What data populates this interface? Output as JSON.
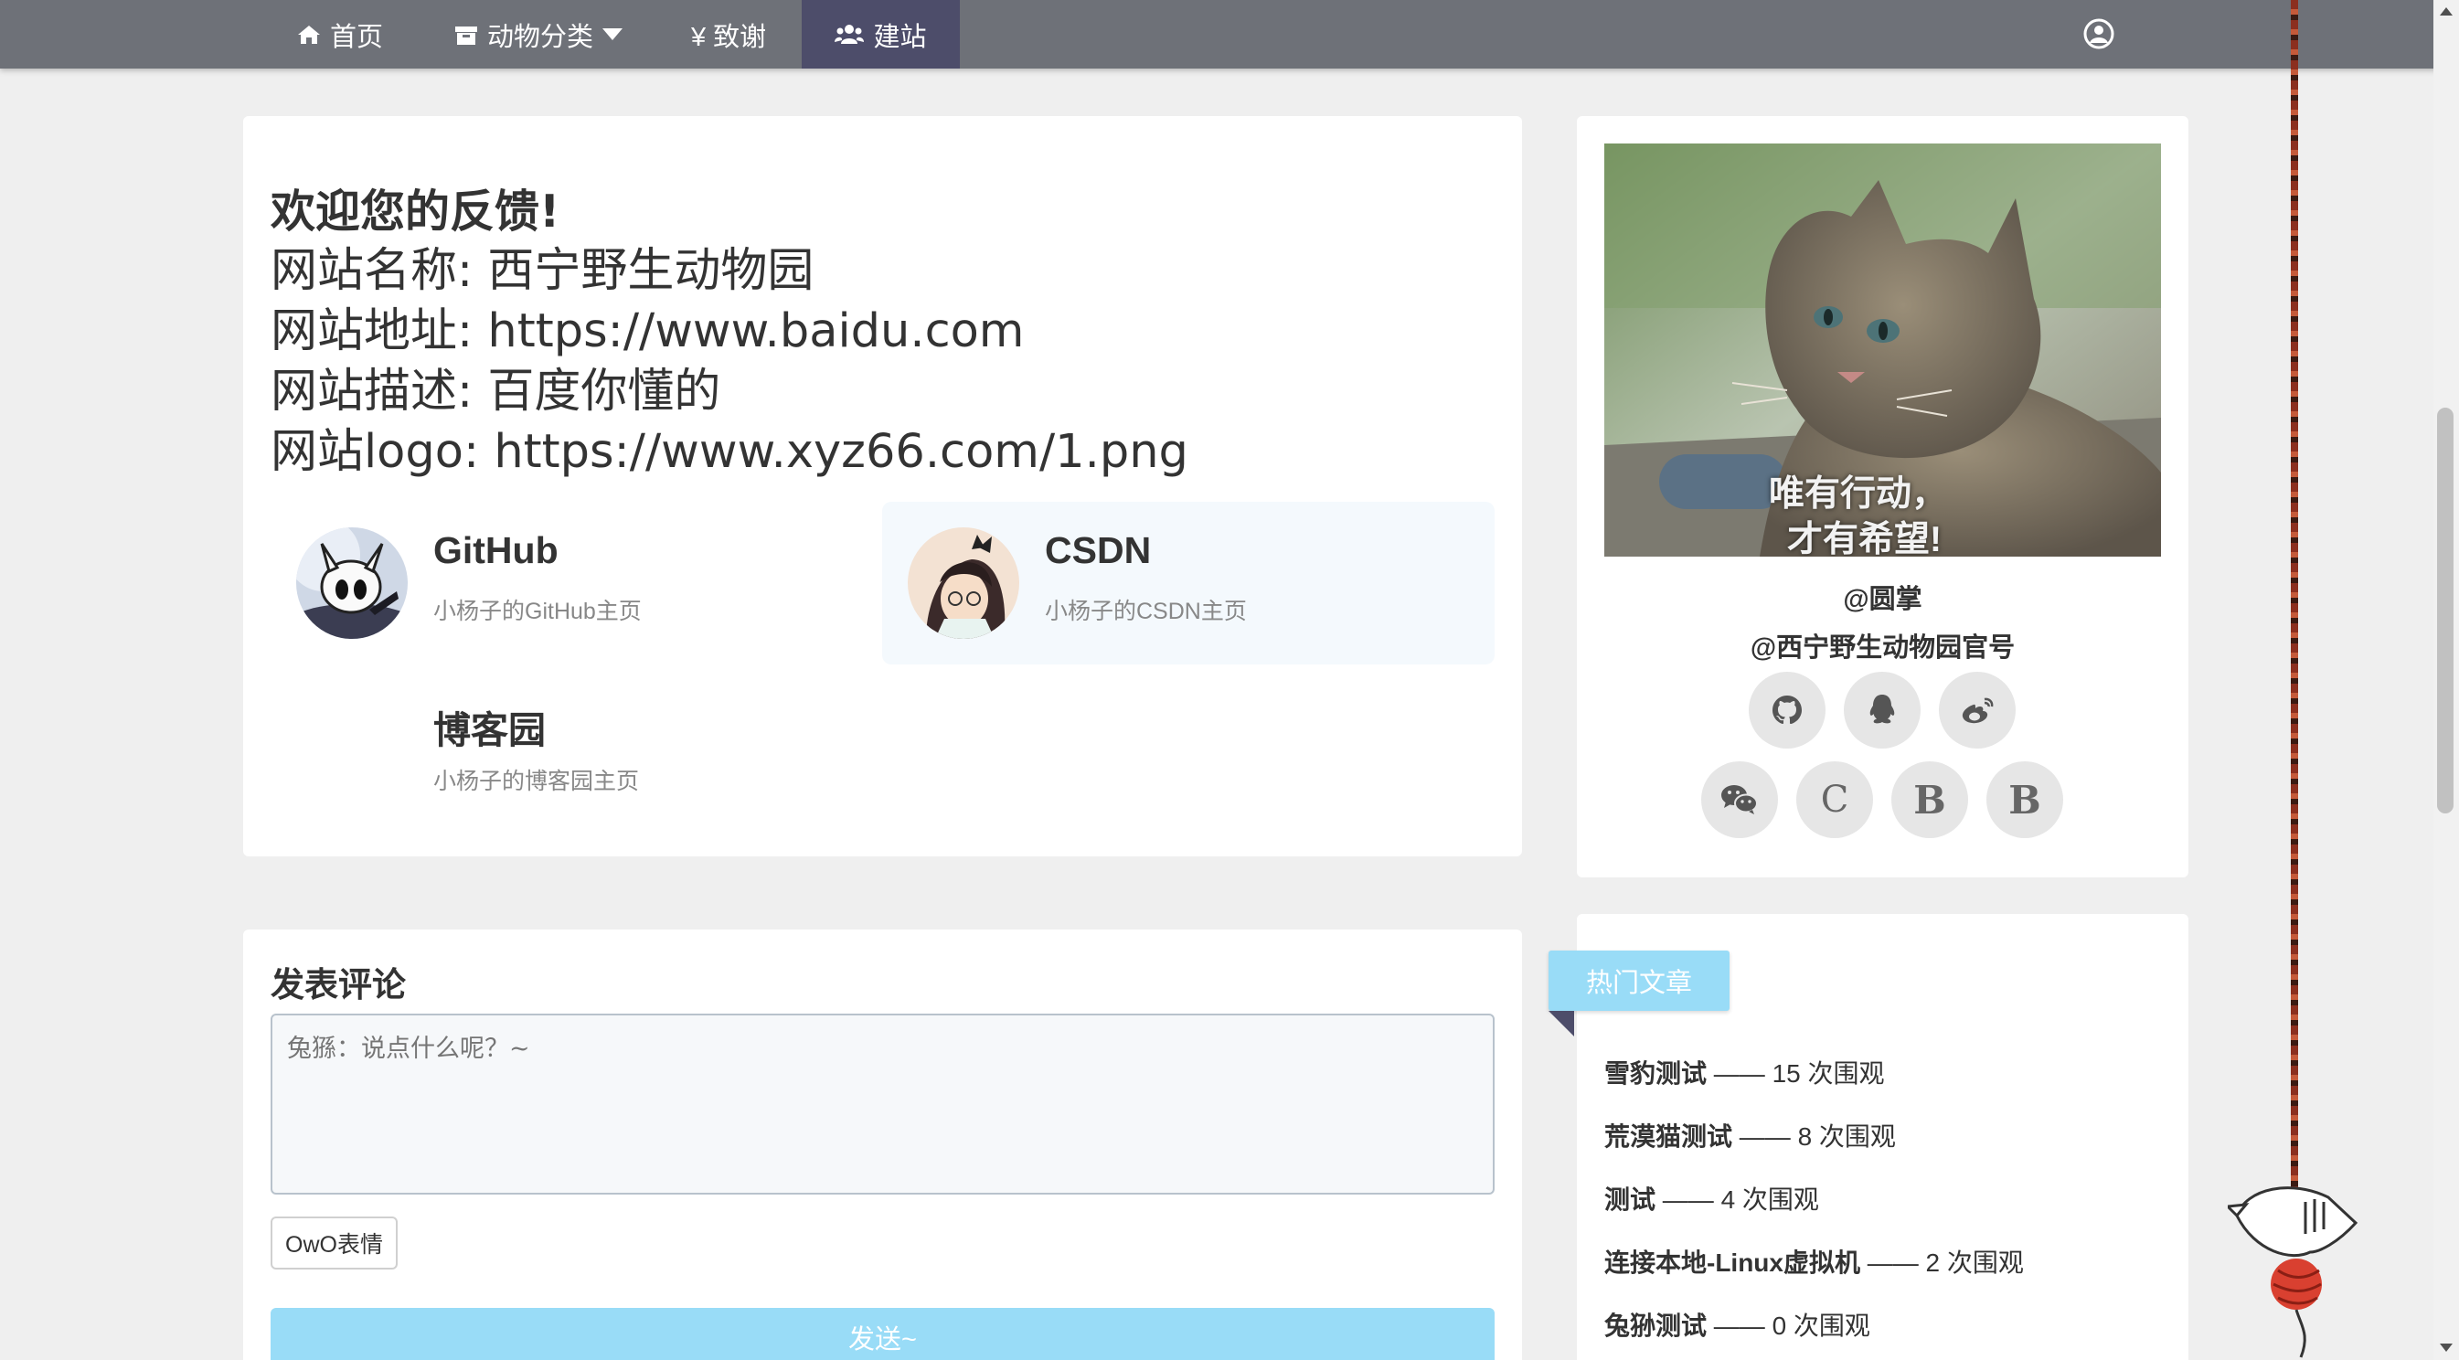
{
  "nav": {
    "home": "首页",
    "animals": "动物分类",
    "thanks": "¥ 致谢",
    "build": "建站"
  },
  "feedback": {
    "title": "欢迎您的反馈!",
    "lines": [
      "网站名称: 西宁野生动物园",
      "网站地址: https://www.baidu.com",
      "网站描述: 百度你懂的",
      "网站logo: https://www.xyz66.com/1.png"
    ],
    "links": [
      {
        "name": "GitHub",
        "desc": "小杨子的GitHub主页"
      },
      {
        "name": "CSDN",
        "desc": "小杨子的CSDN主页"
      },
      {
        "name": "博客园",
        "desc": "小杨子的博客园主页"
      }
    ]
  },
  "comment": {
    "title": "发表评论",
    "placeholder": "兔猻：说点什么呢？~",
    "owo": "OwO表情",
    "send": "发送~"
  },
  "profile": {
    "caption_line1": "唯有行动，",
    "caption_line2": "才有希望!",
    "name1": "@圆掌",
    "name2": "@西宁野生动物园官号",
    "socials": [
      "github-icon",
      "qq-icon",
      "weibo-icon",
      "wechat-icon",
      "C",
      "B",
      "B"
    ]
  },
  "hot": {
    "title": "热门文章",
    "items": [
      {
        "name": "雪豹测试",
        "views": " —— 15 次围观"
      },
      {
        "name": "荒漠猫测试",
        "views": " —— 8 次围观"
      },
      {
        "name": "测试",
        "views": " —— 4 次围观"
      },
      {
        "name": "连接本地-Linux虚拟机",
        "views": " —— 2 次围观"
      },
      {
        "name": "兔狲测试",
        "views": " —— 0 次围观"
      }
    ]
  }
}
